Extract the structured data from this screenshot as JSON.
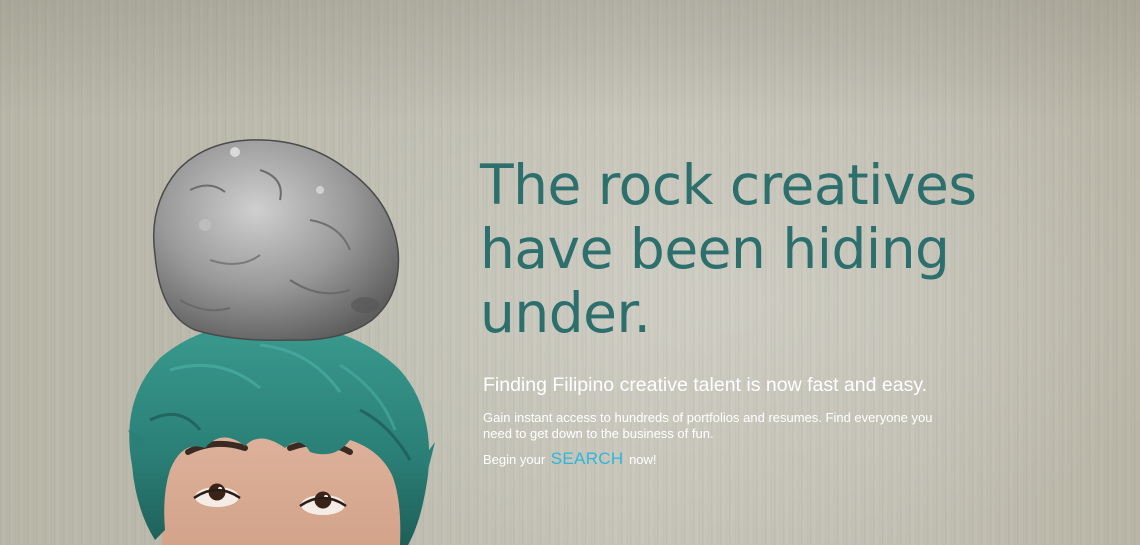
{
  "hero": {
    "headline_lines": [
      "The rock creatives",
      "have been hiding",
      "under."
    ],
    "tagline": "Finding Filipino creative talent is now fast and easy.",
    "description": "Gain instant access to hundreds of portfolios and resumes. Find everyone you need to get down to the business of fun.",
    "cta": {
      "prefix": "Begin your",
      "link_label": "SEARCH",
      "suffix": "now!"
    }
  },
  "theme": {
    "headline_color": "#2c6f6c",
    "link_color": "#2fb6dc",
    "text_color": "#ffffff",
    "background": "#c2c0b3",
    "hair_color": "#2f8d83"
  },
  "icons": {
    "rock": "rock-icon",
    "person": "person-illustration"
  }
}
